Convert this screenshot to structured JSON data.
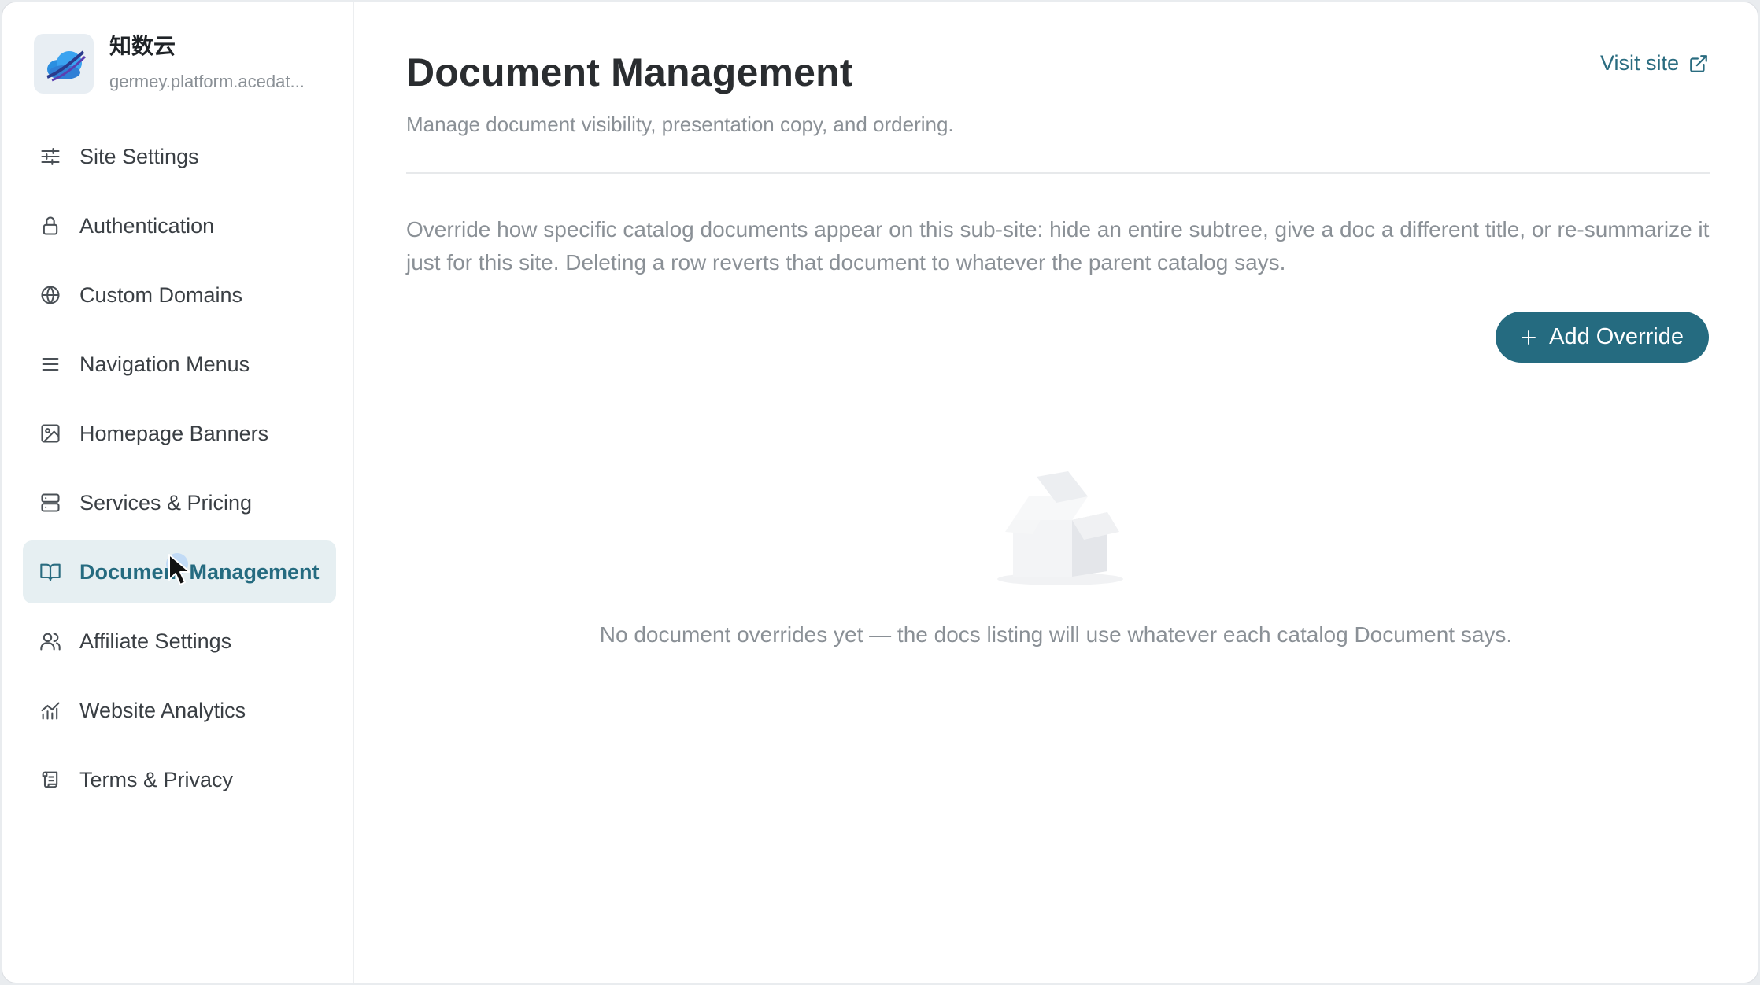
{
  "brand": {
    "name": "知数云",
    "domain": "germey.platform.acedat..."
  },
  "sidebar": {
    "items": [
      {
        "label": "Site Settings",
        "icon": "sliders-icon",
        "active": false
      },
      {
        "label": "Authentication",
        "icon": "lock-icon",
        "active": false
      },
      {
        "label": "Custom Domains",
        "icon": "globe-icon",
        "active": false
      },
      {
        "label": "Navigation Menus",
        "icon": "menu-icon",
        "active": false
      },
      {
        "label": "Homepage Banners",
        "icon": "image-icon",
        "active": false
      },
      {
        "label": "Services & Pricing",
        "icon": "server-icon",
        "active": false
      },
      {
        "label": "Document Management",
        "icon": "book-open-icon",
        "active": true
      },
      {
        "label": "Affiliate Settings",
        "icon": "users-icon",
        "active": false
      },
      {
        "label": "Website Analytics",
        "icon": "chart-icon",
        "active": false
      },
      {
        "label": "Terms & Privacy",
        "icon": "scroll-icon",
        "active": false
      }
    ]
  },
  "main": {
    "title": "Document Management",
    "subtitle": "Manage document visibility, presentation copy, and ordering.",
    "visit_site_label": "Visit site",
    "description": "Override how specific catalog documents appear on this sub-site: hide an entire subtree, give a doc a different title, or re-summarize it just for this site. Deleting a row reverts that document to whatever the parent catalog says.",
    "add_button_label": "Add Override",
    "empty_text": "No document overrides yet — the docs listing will use whatever each catalog Document says."
  },
  "colors": {
    "accent": "#256b80",
    "active_bg": "#e6eff2",
    "muted_text": "#8a9096"
  }
}
